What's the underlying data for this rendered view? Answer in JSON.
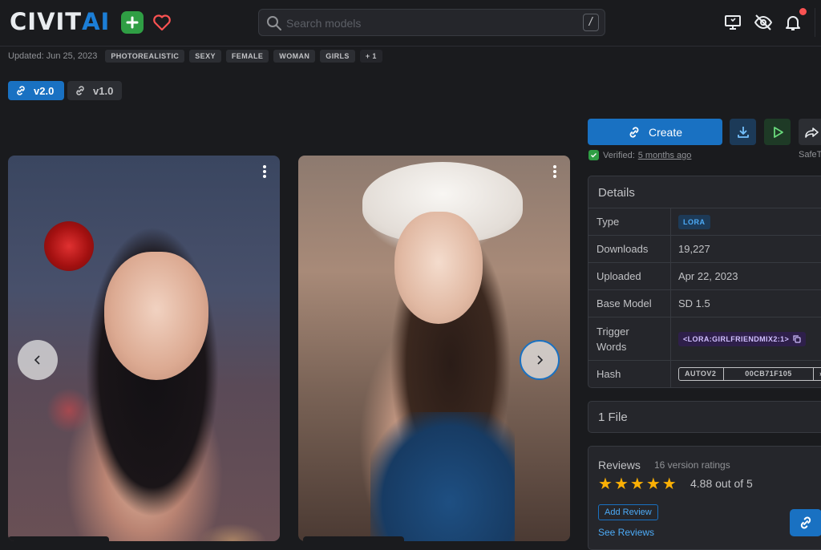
{
  "header": {
    "logo_civ": "CIVIT",
    "logo_ai": "AI",
    "search_placeholder": "Search models",
    "search_shortcut": "/"
  },
  "meta": {
    "updated": "Updated: Jun 25, 2023",
    "tags": [
      "PHOTOREALISTIC",
      "SEXY",
      "FEMALE",
      "WOMAN",
      "GIRLS"
    ],
    "more_tags": "+ 1"
  },
  "versions": [
    "v2.0",
    "v1.0"
  ],
  "actions": {
    "create_label": "Create",
    "verified_label": "Verified:",
    "verified_time": "5 months ago",
    "safe_label": "SafeT"
  },
  "details": {
    "title": "Details",
    "rows": [
      {
        "key": "Type",
        "value": "LORA"
      },
      {
        "key": "Downloads",
        "value": "19,227"
      },
      {
        "key": "Uploaded",
        "value": "Apr 22, 2023"
      },
      {
        "key": "Base Model",
        "value": "SD 1.5"
      },
      {
        "key": "Trigger Words",
        "value": "<LORA:GIRLFRIENDMIX2:1>"
      },
      {
        "key": "Hash",
        "hash_type": "AUTOV2",
        "hash_value": "00CB71F105"
      }
    ]
  },
  "files": {
    "label": "1 File"
  },
  "reviews": {
    "title": "Reviews",
    "count": "16 version ratings",
    "rating": "4.88 out of 5",
    "stars": 5,
    "add_review": "Add Review",
    "see_reviews": "See Reviews"
  },
  "colors": {
    "accent": "#1971c2",
    "brand_green": "#2f9e44",
    "star": "#fab005",
    "notif": "#fa5252"
  }
}
